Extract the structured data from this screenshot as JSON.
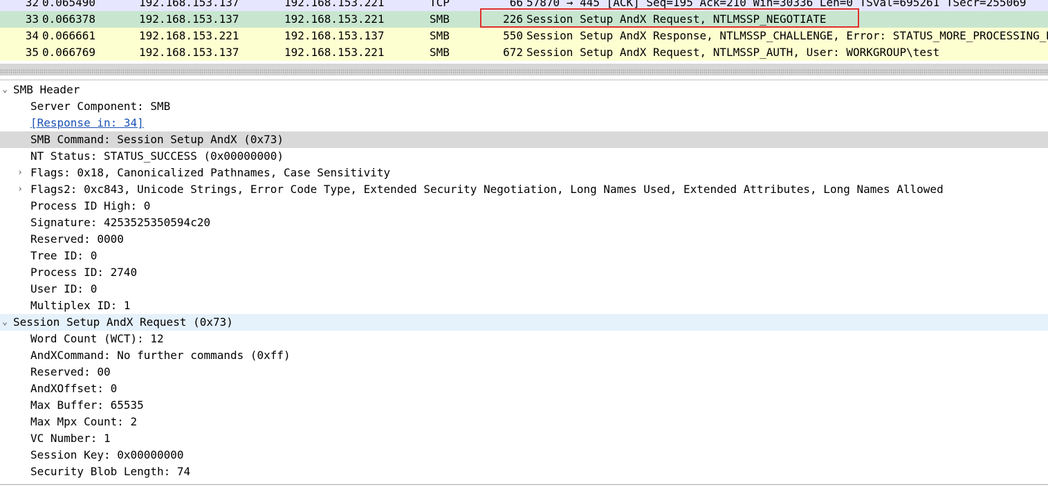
{
  "packet_list": {
    "rows": [
      {
        "no": "32",
        "time": "0.065490",
        "src": "192.168.153.137",
        "dst": "192.168.153.221",
        "proto": "TCP",
        "len": "66",
        "info": "57870 → 445 [ACK] Seq=195 Ack=210 Win=30336 Len=0 TSval=695261 TSecr=255069",
        "bg": "#e7e6ff"
      },
      {
        "no": "33",
        "time": "0.066378",
        "src": "192.168.153.137",
        "dst": "192.168.153.221",
        "proto": "SMB",
        "len": "226",
        "info": "Session Setup AndX Request, NTLMSSP_NEGOTIATE",
        "bg": "#c8e6cf"
      },
      {
        "no": "34",
        "time": "0.066661",
        "src": "192.168.153.221",
        "dst": "192.168.153.137",
        "proto": "SMB",
        "len": "550",
        "info": "Session Setup AndX Response, NTLMSSP_CHALLENGE, Error: STATUS_MORE_PROCESSING_REQUIRED",
        "bg": "#feffd0"
      },
      {
        "no": "35",
        "time": "0.066769",
        "src": "192.168.153.137",
        "dst": "192.168.153.221",
        "proto": "SMB",
        "len": "672",
        "info": "Session Setup AndX Request, NTLMSSP_AUTH, User: WORKGROUP\\test",
        "bg": "#feffd0"
      }
    ],
    "highlight_color": "#e0302d"
  },
  "details": {
    "smb_header": {
      "label": "SMB Header",
      "server_component": "Server Component: SMB",
      "response_in": "[Response in: 34]",
      "smb_command": "SMB Command: Session Setup AndX (0x73)",
      "nt_status": "NT Status: STATUS_SUCCESS (0x00000000)",
      "flags": "Flags: 0x18, Canonicalized Pathnames, Case Sensitivity",
      "flags2": "Flags2: 0xc843, Unicode Strings, Error Code Type, Extended Security Negotiation, Long Names Used, Extended Attributes, Long Names Allowed",
      "pid_high": "Process ID High: 0",
      "signature": "Signature: 4253525350594c20",
      "reserved": "Reserved: 0000",
      "tree_id": "Tree ID: 0",
      "process_id": "Process ID: 2740",
      "user_id": "User ID: 0",
      "multiplex_id": "Multiplex ID: 1"
    },
    "session_setup": {
      "label": "Session Setup AndX Request (0x73)",
      "word_count": "Word Count (WCT): 12",
      "andx_command": "AndXCommand: No further commands (0xff)",
      "reserved": "Reserved: 00",
      "andx_offset": "AndXOffset: 0",
      "max_buffer": "Max Buffer: 65535",
      "max_mpx": "Max Mpx Count: 2",
      "vc_number": "VC Number: 1",
      "session_key": "Session Key: 0x00000000",
      "security_blob_length": "Security Blob Length: 74"
    },
    "selected_row_color": "#d9d9d9",
    "hover_row_color": "#e5f1fb",
    "link_color": "#1a51b2"
  },
  "icons": {
    "expanded": "chevron-down-icon",
    "collapsed": "chevron-right-icon"
  }
}
